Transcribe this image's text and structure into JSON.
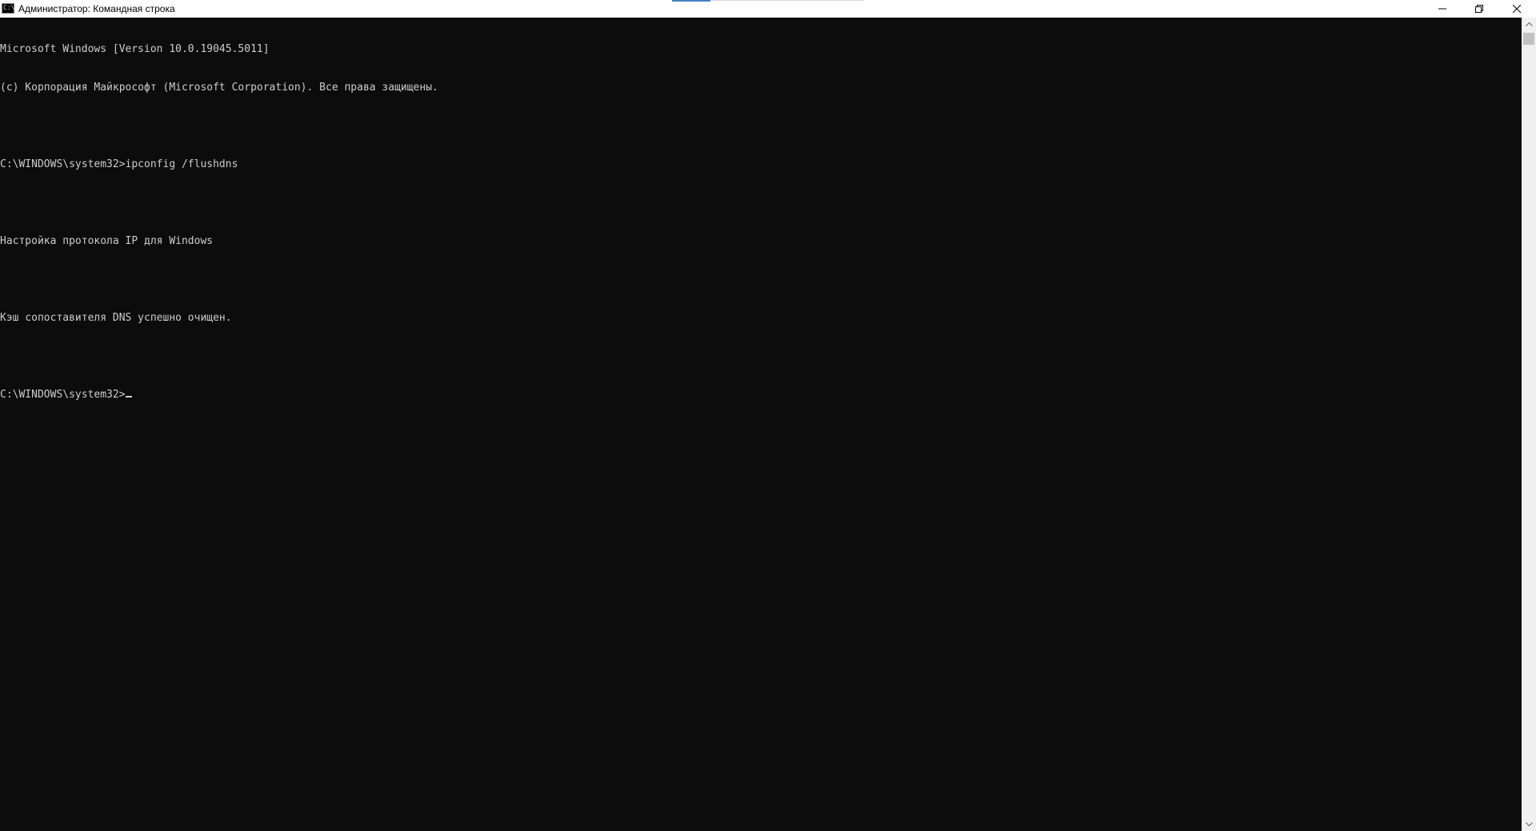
{
  "window": {
    "title": "Администратор: Командная строка",
    "icon": "cmd-icon",
    "icon_glyph": "C:\\",
    "controls": {
      "minimize_icon": "minimize-icon",
      "restore_icon": "restore-icon",
      "close_icon": "close-icon"
    }
  },
  "console": {
    "background": "#0c0c0c",
    "foreground": "#cccccc",
    "lines": [
      "Microsoft Windows [Version 10.0.19045.5011]",
      "(c) Корпорация Майкрософт (Microsoft Corporation). Все права защищены.",
      "",
      "C:\\WINDOWS\\system32>ipconfig /flushdns",
      "",
      "Настройка протокола IP для Windows",
      "",
      "Кэш сопоставителя DNS успешно очищен.",
      "",
      "C:\\WINDOWS\\system32>"
    ]
  },
  "scrollbar": {
    "up_icon": "scroll-up-arrow-icon",
    "down_icon": "scroll-down-arrow-icon"
  }
}
